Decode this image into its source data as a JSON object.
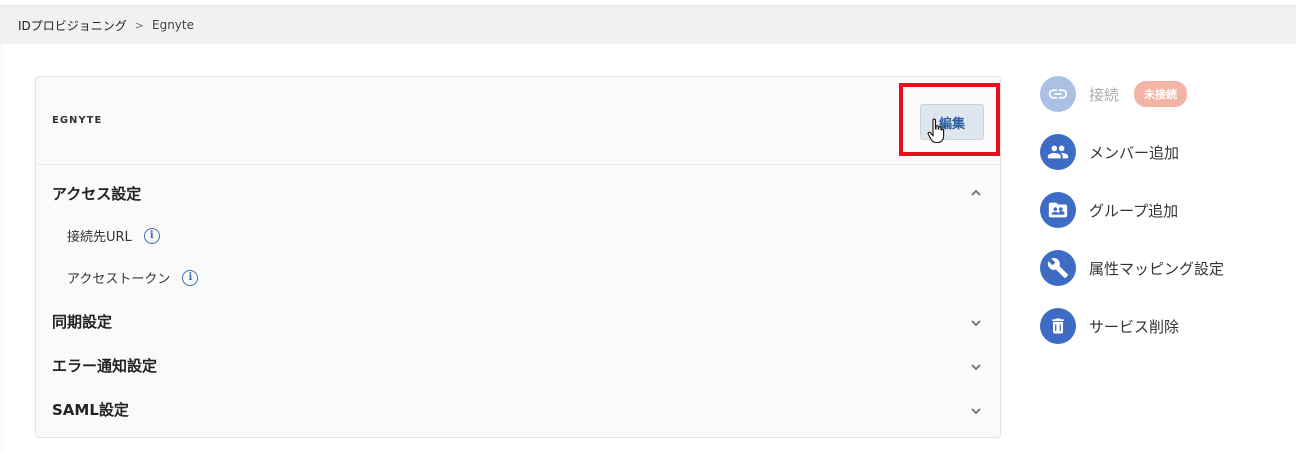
{
  "breadcrumb": {
    "parent": "IDプロビジョニング",
    "separator": ">",
    "current": "Egnyte"
  },
  "card": {
    "logo_text": "EGNYTE",
    "edit_label": "編集",
    "sections": [
      {
        "label": "アクセス設定",
        "expanded": true
      },
      {
        "label": "同期設定",
        "expanded": false
      },
      {
        "label": "エラー通知設定",
        "expanded": false
      },
      {
        "label": "SAML設定",
        "expanded": false
      }
    ],
    "access_items": [
      {
        "label": "接続先URL",
        "info": "i"
      },
      {
        "label": "アクセストークン",
        "info": "i"
      }
    ]
  },
  "side_menu": {
    "connect": {
      "label": "接続",
      "badge": "未接続",
      "icon": "link-icon"
    },
    "items": [
      {
        "label": "メンバー追加",
        "icon": "members-icon"
      },
      {
        "label": "グループ追加",
        "icon": "group-folder-icon"
      },
      {
        "label": "属性マッピング設定",
        "icon": "wrench-icon"
      },
      {
        "label": "サービス削除",
        "icon": "trash-icon"
      }
    ]
  },
  "colors": {
    "accent": "#3e6cc5",
    "accent_disabled": "#aac0e4",
    "badge": "#f3b4a6",
    "highlight": "#e3121b",
    "button_bg": "#dfe6ee"
  }
}
